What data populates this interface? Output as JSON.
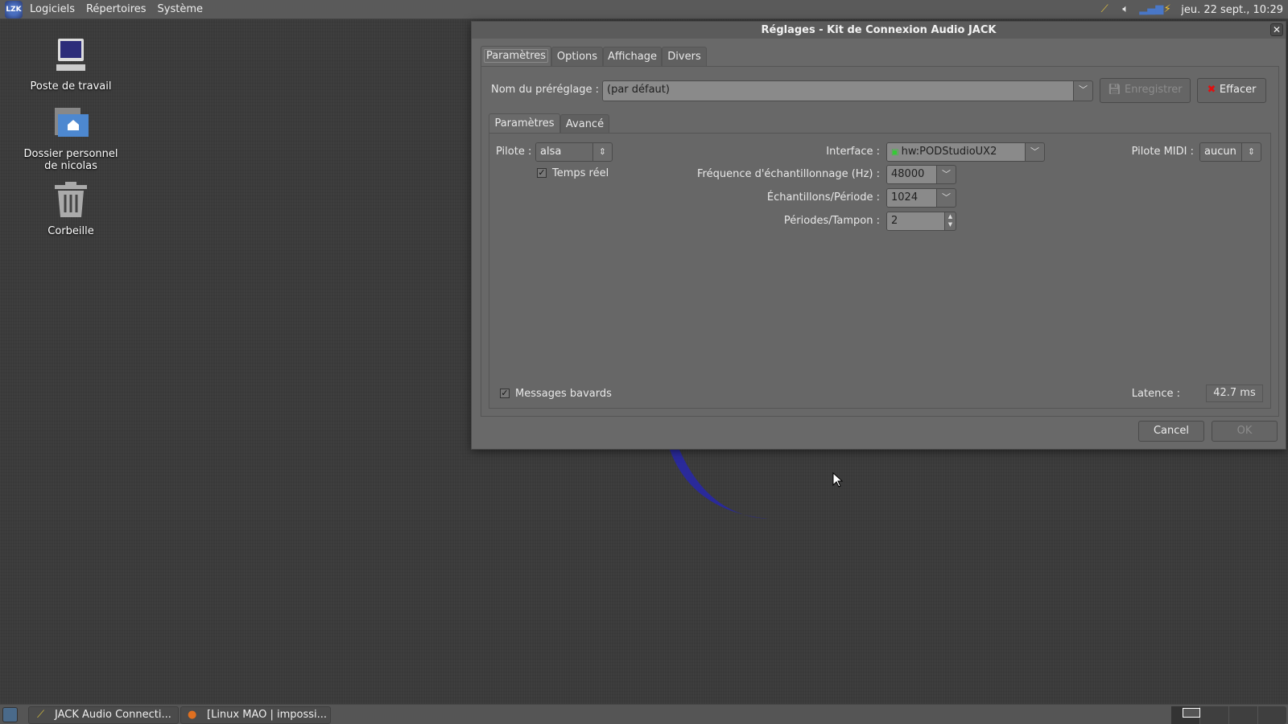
{
  "top_panel": {
    "logo": "LZK",
    "menus": [
      "Logiciels",
      "Répertoires",
      "Système"
    ],
    "clock": "jeu. 22 sept., 10:29",
    "tray_icons": [
      "jack-icon",
      "volume-icon",
      "network-signal-icon",
      "battery-power-icon"
    ]
  },
  "desktop": {
    "icons": [
      {
        "label": "Poste de travail",
        "icon": "computer-icon"
      },
      {
        "label": "Dossier personnel de nicolas",
        "icon": "home-folder-icon"
      },
      {
        "label": "Corbeille",
        "icon": "trash-icon"
      }
    ]
  },
  "dialog": {
    "title": "Réglages - Kit de Connexion Audio JACK",
    "tabs": [
      "Paramètres",
      "Options",
      "Affichage",
      "Divers"
    ],
    "preset_label": "Nom du préréglage :",
    "preset_value": "(par défaut)",
    "save_label": "Enregistrer",
    "delete_label": "Effacer",
    "subtabs": [
      "Paramètres",
      "Avancé"
    ],
    "driver_label": "Pilote :",
    "driver_value": "alsa",
    "realtime_label": "Temps réel",
    "realtime_checked": true,
    "interface_label": "Interface :",
    "interface_value": "hw:PODStudioUX2",
    "midi_label": "Pilote MIDI :",
    "midi_value": "aucun",
    "rate_label": "Fréquence d'échantillonnage (Hz) :",
    "rate_value": "48000",
    "frames_label": "Échantillons/Période :",
    "frames_value": "1024",
    "periods_label": "Périodes/Tampon :",
    "periods_value": "2",
    "verbose_label": "Messages bavards",
    "verbose_checked": true,
    "latency_label": "Latence :",
    "latency_value": "42.7 ms",
    "cancel_label": "Cancel",
    "ok_label": "OK"
  },
  "taskbar": {
    "tasks": [
      "JACK Audio Connecti...",
      "[Linux MAO | impossi..."
    ]
  }
}
